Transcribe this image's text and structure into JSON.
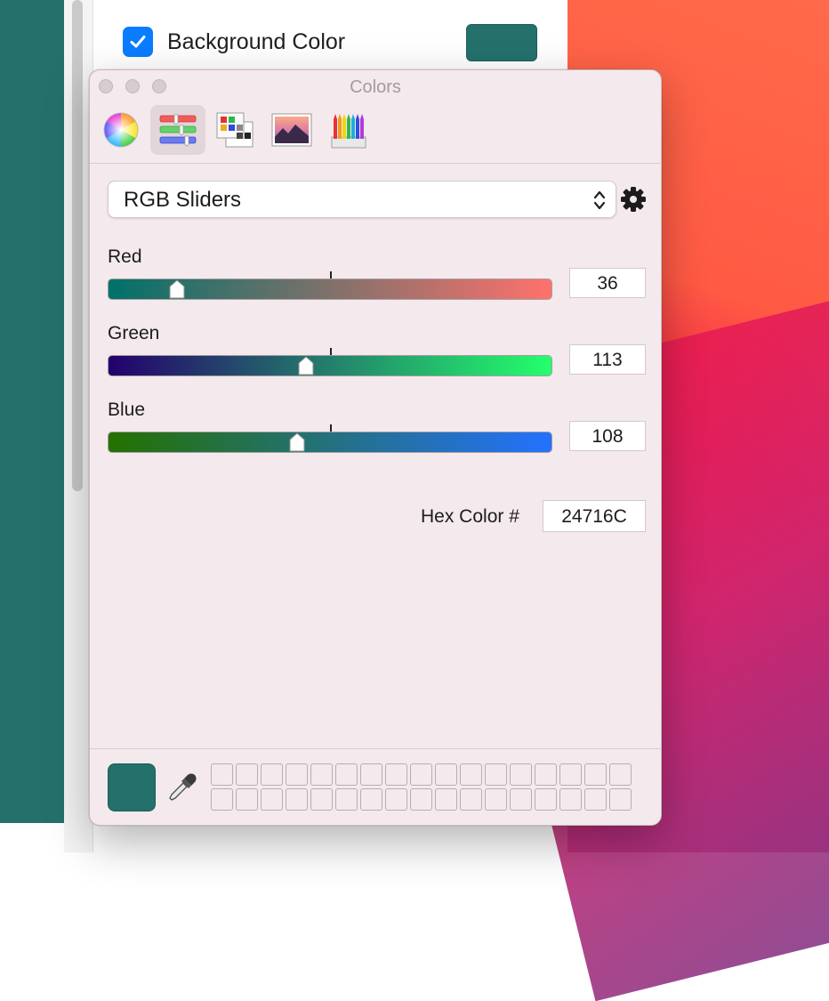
{
  "background": {
    "checkbox_label": "Background Color",
    "checkbox_checked": true,
    "well_color": "#24716c"
  },
  "window": {
    "title": "Colors",
    "toolbar": [
      {
        "name": "color-wheel",
        "icon": "color-wheel-icon"
      },
      {
        "name": "color-sliders",
        "icon": "sliders-icon",
        "selected": true
      },
      {
        "name": "color-palettes",
        "icon": "palette-icon"
      },
      {
        "name": "image-palettes",
        "icon": "image-icon"
      },
      {
        "name": "pencils",
        "icon": "pencils-icon"
      }
    ],
    "mode": "RGB Sliders",
    "channels": [
      {
        "label": "Red",
        "value": "36",
        "max": 255,
        "from": "#007169",
        "to": "#ff716c"
      },
      {
        "label": "Green",
        "value": "113",
        "max": 255,
        "from": "#24006c",
        "to": "#24ff6c"
      },
      {
        "label": "Blue",
        "value": "108",
        "max": 255,
        "from": "#247100",
        "to": "#2471ff"
      }
    ],
    "hex_label": "Hex Color #",
    "hex_value": "24716C",
    "current_color": "#24716c"
  },
  "colors": {
    "accent": "#0a7cff",
    "window_bg": "#f4e9ec"
  }
}
